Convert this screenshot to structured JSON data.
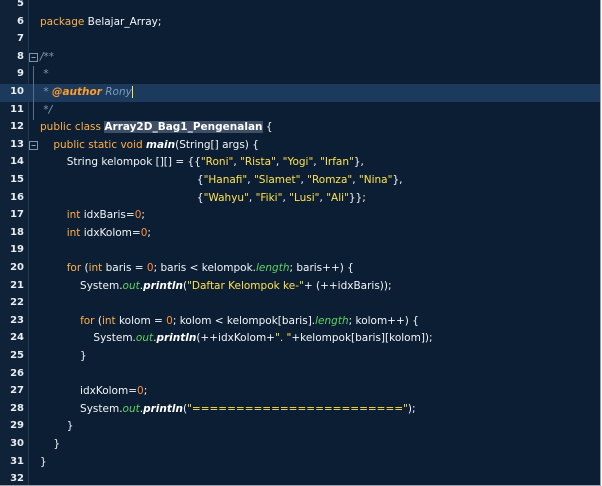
{
  "editor": {
    "colors": {
      "background": "#0b1e33",
      "current_line": "#1c3a5c",
      "keyword": "#ffb04a",
      "string": "#ffe24d",
      "number": "#ff8c3a",
      "comment": "#7f9bc0",
      "field": "#5fd35f"
    },
    "highlighted_line": "10",
    "lines": [
      {
        "num": "5",
        "fold": "",
        "tokens": []
      },
      {
        "num": "6",
        "fold": "",
        "tokens": [
          [
            "kw",
            "package"
          ],
          [
            "plain",
            " Belajar_Array;"
          ]
        ]
      },
      {
        "num": "7",
        "fold": "",
        "tokens": []
      },
      {
        "num": "8",
        "fold": "−",
        "tokens": [
          [
            "cm",
            "/**"
          ]
        ]
      },
      {
        "num": "9",
        "fold": "│",
        "tokens": [
          [
            "cm",
            " *"
          ]
        ]
      },
      {
        "num": "10",
        "fold": "│",
        "tokens": [
          [
            "cm",
            " * "
          ],
          [
            "tag",
            "@author"
          ],
          [
            "cm",
            " Rony"
          ],
          [
            "caret",
            ""
          ]
        ]
      },
      {
        "num": "11",
        "fold": "│",
        "tokens": [
          [
            "cm",
            " */"
          ]
        ]
      },
      {
        "num": "12",
        "fold": "",
        "tokens": [
          [
            "kw",
            "public class "
          ],
          [
            "cls",
            "Array2D_Bag1_Pengenalan"
          ],
          [
            "plain",
            " {"
          ]
        ]
      },
      {
        "num": "13",
        "fold": "−",
        "tokens": [
          [
            "plain",
            "    "
          ],
          [
            "kw",
            "public static void "
          ],
          [
            "meth",
            "main"
          ],
          [
            "plain",
            "(String[] args) {"
          ]
        ]
      },
      {
        "num": "14",
        "fold": "",
        "tokens": [
          [
            "plain",
            "        String kelompok [][] = {{"
          ],
          [
            "str",
            "\"Roni\""
          ],
          [
            "plain",
            ", "
          ],
          [
            "str",
            "\"Rista\""
          ],
          [
            "plain",
            ", "
          ],
          [
            "str",
            "\"Yogi\""
          ],
          [
            "plain",
            ", "
          ],
          [
            "str",
            "\"Irfan\""
          ],
          [
            "plain",
            "},"
          ]
        ]
      },
      {
        "num": "15",
        "fold": "",
        "tokens": [
          [
            "plain",
            "                                               {"
          ],
          [
            "str",
            "\"Hanafi\""
          ],
          [
            "plain",
            ", "
          ],
          [
            "str",
            "\"Slamet\""
          ],
          [
            "plain",
            ", "
          ],
          [
            "str",
            "\"Romza\""
          ],
          [
            "plain",
            ", "
          ],
          [
            "str",
            "\"Nina\""
          ],
          [
            "plain",
            "},"
          ]
        ]
      },
      {
        "num": "16",
        "fold": "",
        "tokens": [
          [
            "plain",
            "                                               {"
          ],
          [
            "str",
            "\"Wahyu\""
          ],
          [
            "plain",
            ", "
          ],
          [
            "str",
            "\"Fiki\""
          ],
          [
            "plain",
            ", "
          ],
          [
            "str",
            "\"Lusi\""
          ],
          [
            "plain",
            ", "
          ],
          [
            "str",
            "\"Ali\""
          ],
          [
            "plain",
            "}};"
          ]
        ]
      },
      {
        "num": "17",
        "fold": "",
        "tokens": [
          [
            "plain",
            "        "
          ],
          [
            "kw",
            "int"
          ],
          [
            "plain",
            " idxBaris="
          ],
          [
            "num",
            "0"
          ],
          [
            "plain",
            ";"
          ]
        ]
      },
      {
        "num": "18",
        "fold": "",
        "tokens": [
          [
            "plain",
            "        "
          ],
          [
            "kw",
            "int"
          ],
          [
            "plain",
            " idxKolom="
          ],
          [
            "num",
            "0"
          ],
          [
            "plain",
            ";"
          ]
        ]
      },
      {
        "num": "19",
        "fold": "",
        "tokens": []
      },
      {
        "num": "20",
        "fold": "",
        "tokens": [
          [
            "plain",
            "        "
          ],
          [
            "kw",
            "for"
          ],
          [
            "plain",
            " ("
          ],
          [
            "kw",
            "int"
          ],
          [
            "plain",
            " baris = "
          ],
          [
            "num",
            "0"
          ],
          [
            "plain",
            "; baris < kelompok."
          ],
          [
            "field",
            "length"
          ],
          [
            "plain",
            "; baris++) {"
          ]
        ]
      },
      {
        "num": "21",
        "fold": "",
        "tokens": [
          [
            "plain",
            "            System."
          ],
          [
            "field",
            "out"
          ],
          [
            "plain",
            "."
          ],
          [
            "meth",
            "println"
          ],
          [
            "plain",
            "("
          ],
          [
            "str",
            "\"Daftar Kelompok ke-\""
          ],
          [
            "plain",
            "+ (++idxBaris));"
          ]
        ]
      },
      {
        "num": "22",
        "fold": "",
        "tokens": []
      },
      {
        "num": "23",
        "fold": "",
        "tokens": [
          [
            "plain",
            "            "
          ],
          [
            "kw",
            "for"
          ],
          [
            "plain",
            " ("
          ],
          [
            "kw",
            "int"
          ],
          [
            "plain",
            " kolom = "
          ],
          [
            "num",
            "0"
          ],
          [
            "plain",
            "; kolom < kelompok[baris]."
          ],
          [
            "field",
            "length"
          ],
          [
            "plain",
            "; kolom++) {"
          ]
        ]
      },
      {
        "num": "24",
        "fold": "",
        "tokens": [
          [
            "plain",
            "                System."
          ],
          [
            "field",
            "out"
          ],
          [
            "plain",
            "."
          ],
          [
            "meth",
            "println"
          ],
          [
            "plain",
            "(++idxKolom+"
          ],
          [
            "str",
            "\". \""
          ],
          [
            "plain",
            "+kelompok[baris][kolom]);"
          ]
        ]
      },
      {
        "num": "25",
        "fold": "",
        "tokens": [
          [
            "plain",
            "            }"
          ]
        ]
      },
      {
        "num": "26",
        "fold": "",
        "tokens": []
      },
      {
        "num": "27",
        "fold": "",
        "tokens": [
          [
            "plain",
            "            idxKolom="
          ],
          [
            "num",
            "0"
          ],
          [
            "plain",
            ";"
          ]
        ]
      },
      {
        "num": "28",
        "fold": "",
        "tokens": [
          [
            "plain",
            "            System."
          ],
          [
            "field",
            "out"
          ],
          [
            "plain",
            "."
          ],
          [
            "meth",
            "println"
          ],
          [
            "plain",
            "("
          ],
          [
            "str",
            "\"========================\""
          ],
          [
            "plain",
            ");"
          ]
        ]
      },
      {
        "num": "29",
        "fold": "",
        "tokens": [
          [
            "plain",
            "        }"
          ]
        ]
      },
      {
        "num": "30",
        "fold": "",
        "tokens": [
          [
            "plain",
            "    }"
          ]
        ]
      },
      {
        "num": "31",
        "fold": "",
        "tokens": [
          [
            "plain",
            "}"
          ]
        ]
      },
      {
        "num": "32",
        "fold": "",
        "tokens": []
      }
    ]
  }
}
